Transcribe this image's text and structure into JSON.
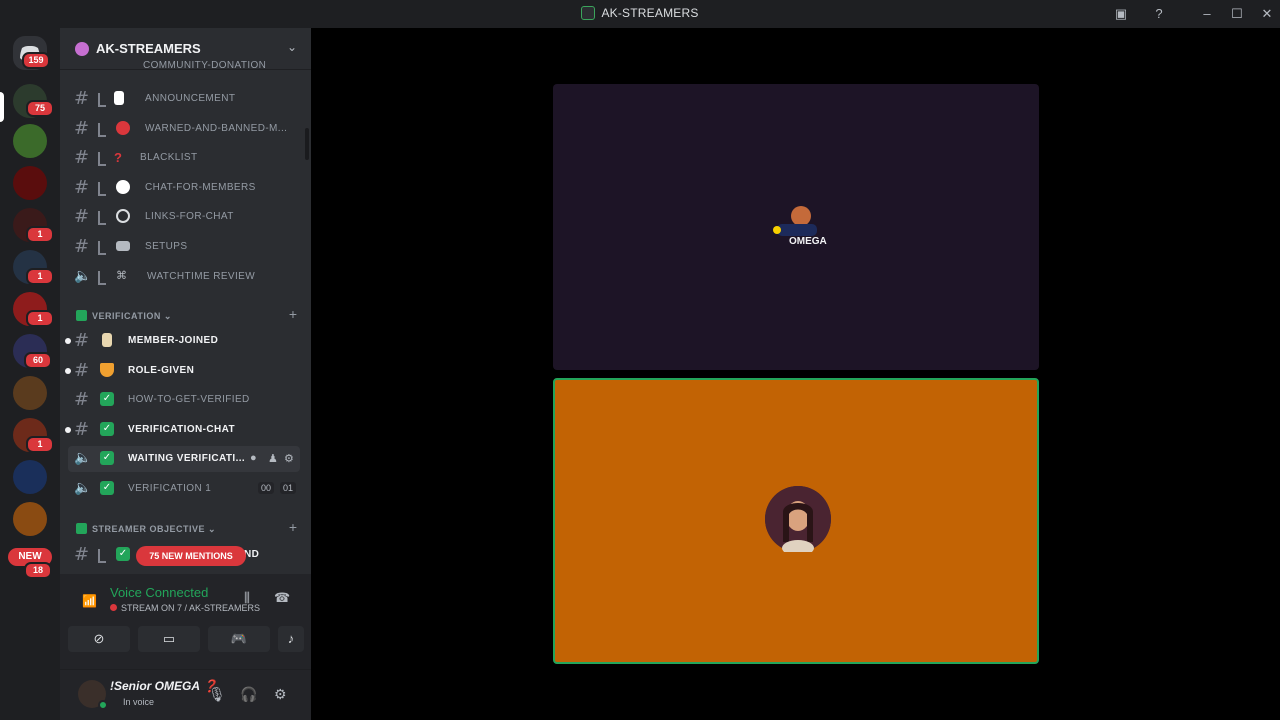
{
  "window": {
    "title": "AK-STREAMERS"
  },
  "rail": {
    "home_badge": "159",
    "servers": [
      {
        "badge": "75"
      },
      {
        "badge": ""
      },
      {
        "badge": ""
      },
      {
        "badge": "1"
      },
      {
        "badge": "1"
      },
      {
        "badge": "1"
      },
      {
        "badge": "60"
      },
      {
        "badge": ""
      },
      {
        "badge": "1"
      },
      {
        "badge": ""
      },
      {
        "badge": ""
      }
    ],
    "new_label": "NEW",
    "new_badge": "18"
  },
  "guild": {
    "name": "AK-STREAMERS"
  },
  "channels_top": [
    {
      "label": "COMMUNITY-DONATION"
    },
    {
      "label": "ANNOUNCEMENT"
    },
    {
      "label": "WARNED-AND-BANNED-M..."
    },
    {
      "label": "BLACKLIST"
    },
    {
      "label": "CHAT-FOR-MEMBERS"
    },
    {
      "label": "LINKS-FOR-CHAT"
    },
    {
      "label": "SETUPS"
    },
    {
      "label": "WATCHTIME REVIEW"
    }
  ],
  "category_verification": {
    "label": "VERIFICATION"
  },
  "channels_verification": [
    {
      "label": "MEMBER-JOINED"
    },
    {
      "label": "ROLE-GIVEN"
    },
    {
      "label": "HOW-TO-GET-VERIFIED"
    },
    {
      "label": "VERIFICATION-CHAT"
    },
    {
      "label": "WAITING VERIFICATI..."
    },
    {
      "label": "VERIFICATION 1",
      "count_a": "00",
      "count_b": "01"
    }
  ],
  "category_streamer": {
    "label": "STREAMER OBJECTIVE"
  },
  "streamer_channel_suffix": "ND",
  "mentions_label": "75 NEW MENTIONS",
  "voice": {
    "title": "Voice Connected",
    "subtitle": "STREAM ON 7 / AK-STREAMERS"
  },
  "user": {
    "name": "!Senior OMEGA ❓",
    "status": "In voice"
  },
  "colors": {
    "accent_green": "#23a55a",
    "mention_red": "#da373c",
    "tile_orange": "#c26304",
    "tile_purple": "#1d1426"
  }
}
